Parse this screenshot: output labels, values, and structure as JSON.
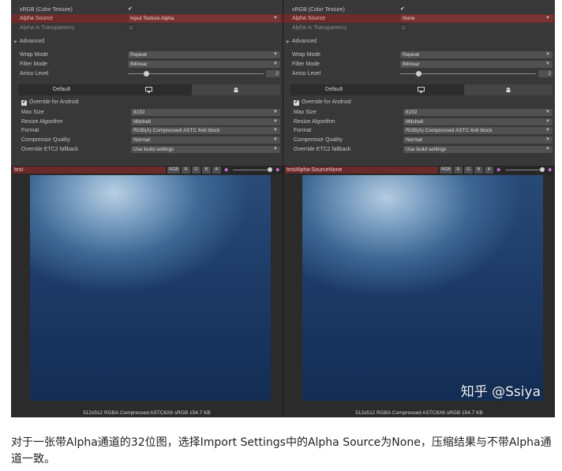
{
  "panels": [
    {
      "srgb_label": "sRGB (Color Texture)",
      "check_glyph": "✔",
      "alpha_source_label": "Alpha Source",
      "alpha_source_value": "Input Texture Alpha",
      "alpha_transparency_label": "Alpha Is Transparency",
      "advanced_label": "Advanced",
      "wrap_mode_label": "Wrap Mode",
      "wrap_mode_value": "Repeat",
      "filter_mode_label": "Filter Mode",
      "filter_mode_value": "Bilinear",
      "aniso_label": "Aniso Level",
      "aniso_value": "2",
      "tab_default": "Default",
      "override_label": "Override for Android",
      "max_size_label": "Max Size",
      "max_size_value": "8192",
      "resize_label": "Resize Algorithm",
      "resize_value": "Mitchell",
      "format_label": "Format",
      "format_value": "RGB(A) Compressed ASTC 6x6 block",
      "quality_label": "Compressor Quality",
      "quality_value": "Normal",
      "etc2_label": "Override ETC2 fallback",
      "etc2_value": "Use build settings",
      "preview_name": "test",
      "btn_rgb": "RGB",
      "btn_r": "R",
      "btn_g": "G",
      "btn_b": "B",
      "btn_a": "A",
      "preview_info": "512x512  RGBA Compressed ASTC6X6 sRGB  154.7 KB"
    },
    {
      "srgb_label": "sRGB (Color Texture)",
      "check_glyph": "✔",
      "alpha_source_label": "Alpha Source",
      "alpha_source_value": "None",
      "alpha_transparency_label": "Alpha Is Transparency",
      "advanced_label": "Advanced",
      "wrap_mode_label": "Wrap Mode",
      "wrap_mode_value": "Repeat",
      "filter_mode_label": "Filter Mode",
      "filter_mode_value": "Bilinear",
      "aniso_label": "Aniso Level",
      "aniso_value": "2",
      "tab_default": "Default",
      "override_label": "Override for Android",
      "max_size_label": "Max Size",
      "max_size_value": "8192",
      "resize_label": "Resize Algorithm",
      "resize_value": "Mitchell",
      "format_label": "Format",
      "format_value": "RGB(A) Compressed ASTC 6x6 block",
      "quality_label": "Compressor Quality",
      "quality_value": "Normal",
      "etc2_label": "Override ETC2 fallback",
      "etc2_value": "Use build settings",
      "preview_name": "testAlpha-SourceNone",
      "btn_rgb": "RGB",
      "btn_r": "R",
      "btn_g": "G",
      "btn_b": "B",
      "btn_a": "A",
      "preview_info": "512x512  RGBA Compressed ASTC6X6 sRGB  154.7 KB"
    }
  ],
  "watermark": "知乎 @Ssiya",
  "caption": "对于一张带Alpha通道的32位图，选择Import Settings中的Alpha Source为None，压缩结果与不带Alpha通道一致。",
  "icons": {
    "dropdown": "dropdown-arrow-icon",
    "monitor": "monitor-icon",
    "android": "android-icon",
    "mipmap": "mipmap-icon",
    "foldout": "foldout-triangle-icon"
  }
}
